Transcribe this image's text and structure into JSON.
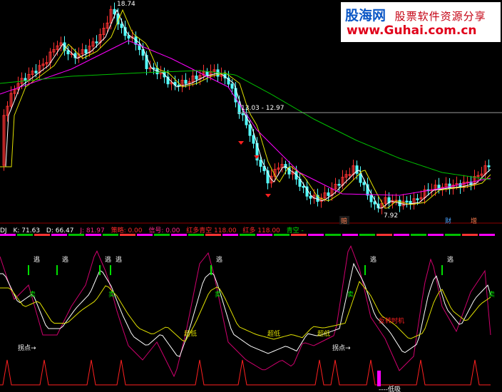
{
  "banner": {
    "brand": "股海网",
    "tagline": "股票软件资源分享",
    "url": "www.Guhai.com.cn"
  },
  "price_panel": {
    "high_label": "18.74",
    "low_label": "7.92",
    "level_label": "13.03 - 12.97",
    "markers": [
      "赔",
      "财",
      "增"
    ]
  },
  "indicator_bar": {
    "name": "DJ",
    "k_label": "K: 71.63",
    "d_label": "D: 66.47",
    "j_label": "J: 81.97",
    "f1": "策略: 0.00",
    "f2": "信号: 0.00",
    "f3": "红多青空 118.00",
    "f4": "红多 118.00",
    "f5": "青空 -"
  },
  "signals": {
    "escape": "逃",
    "sell": "卖",
    "oversold": "超低",
    "turn": "拐点→",
    "rebound": "反转时机",
    "bottom": "----低吸"
  },
  "colors": {
    "up": "#ff3232",
    "down": "#54ffff",
    "ma_yellow": "#e0e000",
    "ma_white": "#ffffff",
    "ma_magenta": "#ff00ff",
    "ma_green": "#00c000",
    "k_line": "#ffffff",
    "d_line": "#e0e000",
    "j_line": "#d0006e"
  }
}
